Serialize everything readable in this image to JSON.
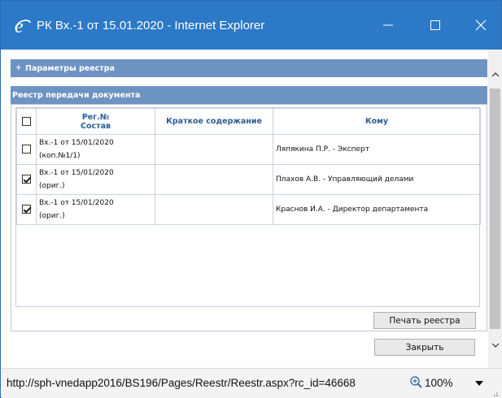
{
  "window": {
    "title": "РК Вх.-1 от 15.01.2020 - Internet Explorer",
    "titlebar_color": "#2b79c7",
    "icons": {
      "app": "internet-explorer-icon",
      "minimize": "minimize-icon",
      "maximize": "maximize-icon",
      "close": "close-icon"
    }
  },
  "panels": {
    "params": {
      "expander": "+",
      "label": "Параметры реестра"
    },
    "reestr": {
      "label": "Реестр передачи документа"
    },
    "header_color": "#6d93c3"
  },
  "table": {
    "headers": {
      "reg_line1": "Рег.№",
      "reg_line2": "Состав",
      "summary": "Краткое содержание",
      "to": "Кому"
    },
    "header_checked": false,
    "rows": [
      {
        "checked": false,
        "reg": "Вх.-1 от 15/01/2020",
        "composition": "(коп.№1/1)",
        "summary": "",
        "to": "Ляпякина П.Р. - Эксперт"
      },
      {
        "checked": true,
        "reg": "Вх.-1 от 15/01/2020",
        "composition": "(ориг.)",
        "summary": "",
        "to": "Плахов А.В. - Управляющий делами"
      },
      {
        "checked": true,
        "reg": "Вх.-1 от 15/01/2020",
        "composition": "(ориг.)",
        "summary": "",
        "to": "Краснов И.А. - Директор департамента"
      }
    ]
  },
  "buttons": {
    "print": "Печать реестра",
    "close": "Закрыть"
  },
  "statusbar": {
    "url": "http://sph-vnedapp2016/BS196/Pages/Reestr/Reestr.aspx?rc_id=46668",
    "zoom": "100%",
    "zoom_icon": "zoom-magnifier-icon"
  }
}
